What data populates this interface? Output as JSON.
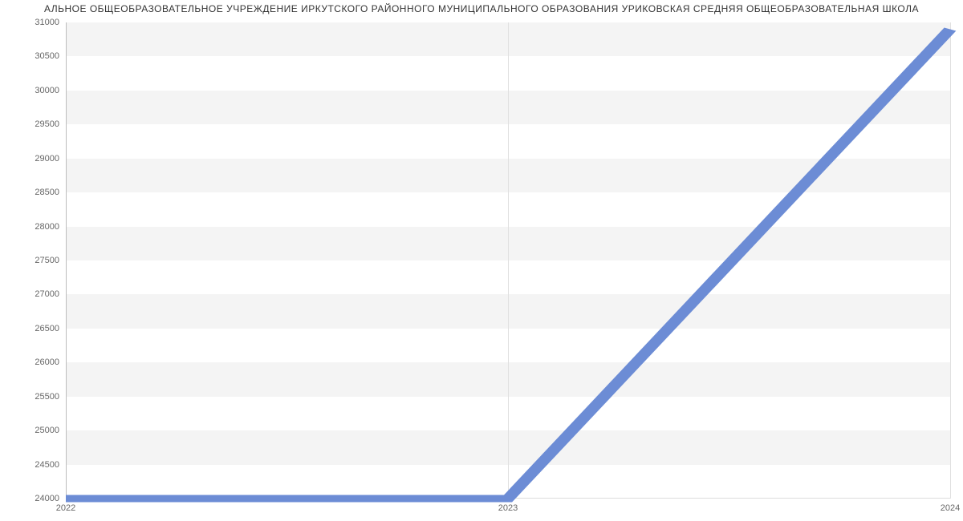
{
  "chart_data": {
    "type": "line",
    "title": "АЛЬНОЕ ОБЩЕОБРАЗОВАТЕЛЬНОЕ УЧРЕЖДЕНИЕ ИРКУТСКОГО РАЙОННОГО МУНИЦИПАЛЬНОГО ОБРАЗОВАНИЯ УРИКОВСКАЯ СРЕДНЯЯ ОБЩЕОБРАЗОВАТЕЛЬНАЯ ШКОЛА",
    "x": [
      2022,
      2023,
      2024
    ],
    "values": [
      24000,
      24000,
      30900
    ],
    "x_ticks": [
      "2022",
      "2023",
      "2024"
    ],
    "y_ticks": [
      24000,
      24500,
      25000,
      25500,
      26000,
      26500,
      27000,
      27500,
      28000,
      28500,
      29000,
      29500,
      30000,
      30500,
      31000
    ],
    "xlim": [
      2022,
      2024
    ],
    "ylim": [
      24000,
      31000
    ],
    "xlabel": "",
    "ylabel": ""
  }
}
